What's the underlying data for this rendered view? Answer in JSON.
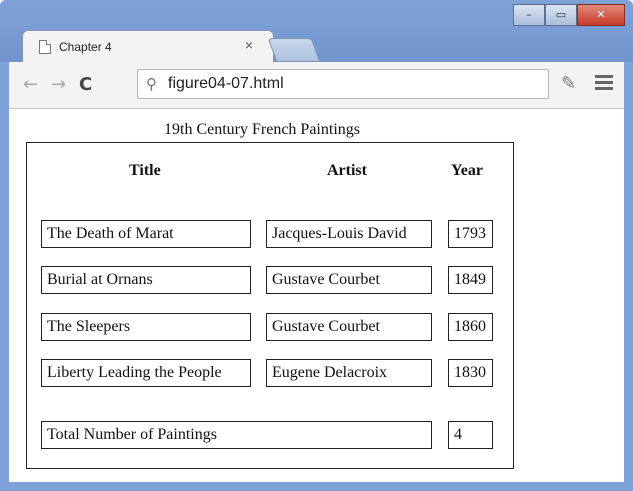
{
  "browser": {
    "tab_title": "Chapter 4",
    "tab_close": "×",
    "url": "figure04-07.html",
    "window_buttons": {
      "minimize": "–",
      "maximize": "▭",
      "close": "✕"
    },
    "nav": {
      "back": "←",
      "forward": "→",
      "reload": "C"
    }
  },
  "page": {
    "title": "19th Century French Paintings",
    "headers": {
      "title": "Title",
      "artist": "Artist",
      "year": "Year"
    },
    "rows": [
      {
        "title": "The Death of Marat",
        "artist": "Jacques-Louis David",
        "year": "1793"
      },
      {
        "title": "Burial at Ornans",
        "artist": "Gustave Courbet",
        "year": "1849"
      },
      {
        "title": "The Sleepers",
        "artist": "Gustave Courbet",
        "year": "1860"
      },
      {
        "title": "Liberty Leading the People",
        "artist": "Eugene Delacroix",
        "year": "1830"
      }
    ],
    "total_label": "Total Number of Paintings",
    "total_value": "4"
  }
}
